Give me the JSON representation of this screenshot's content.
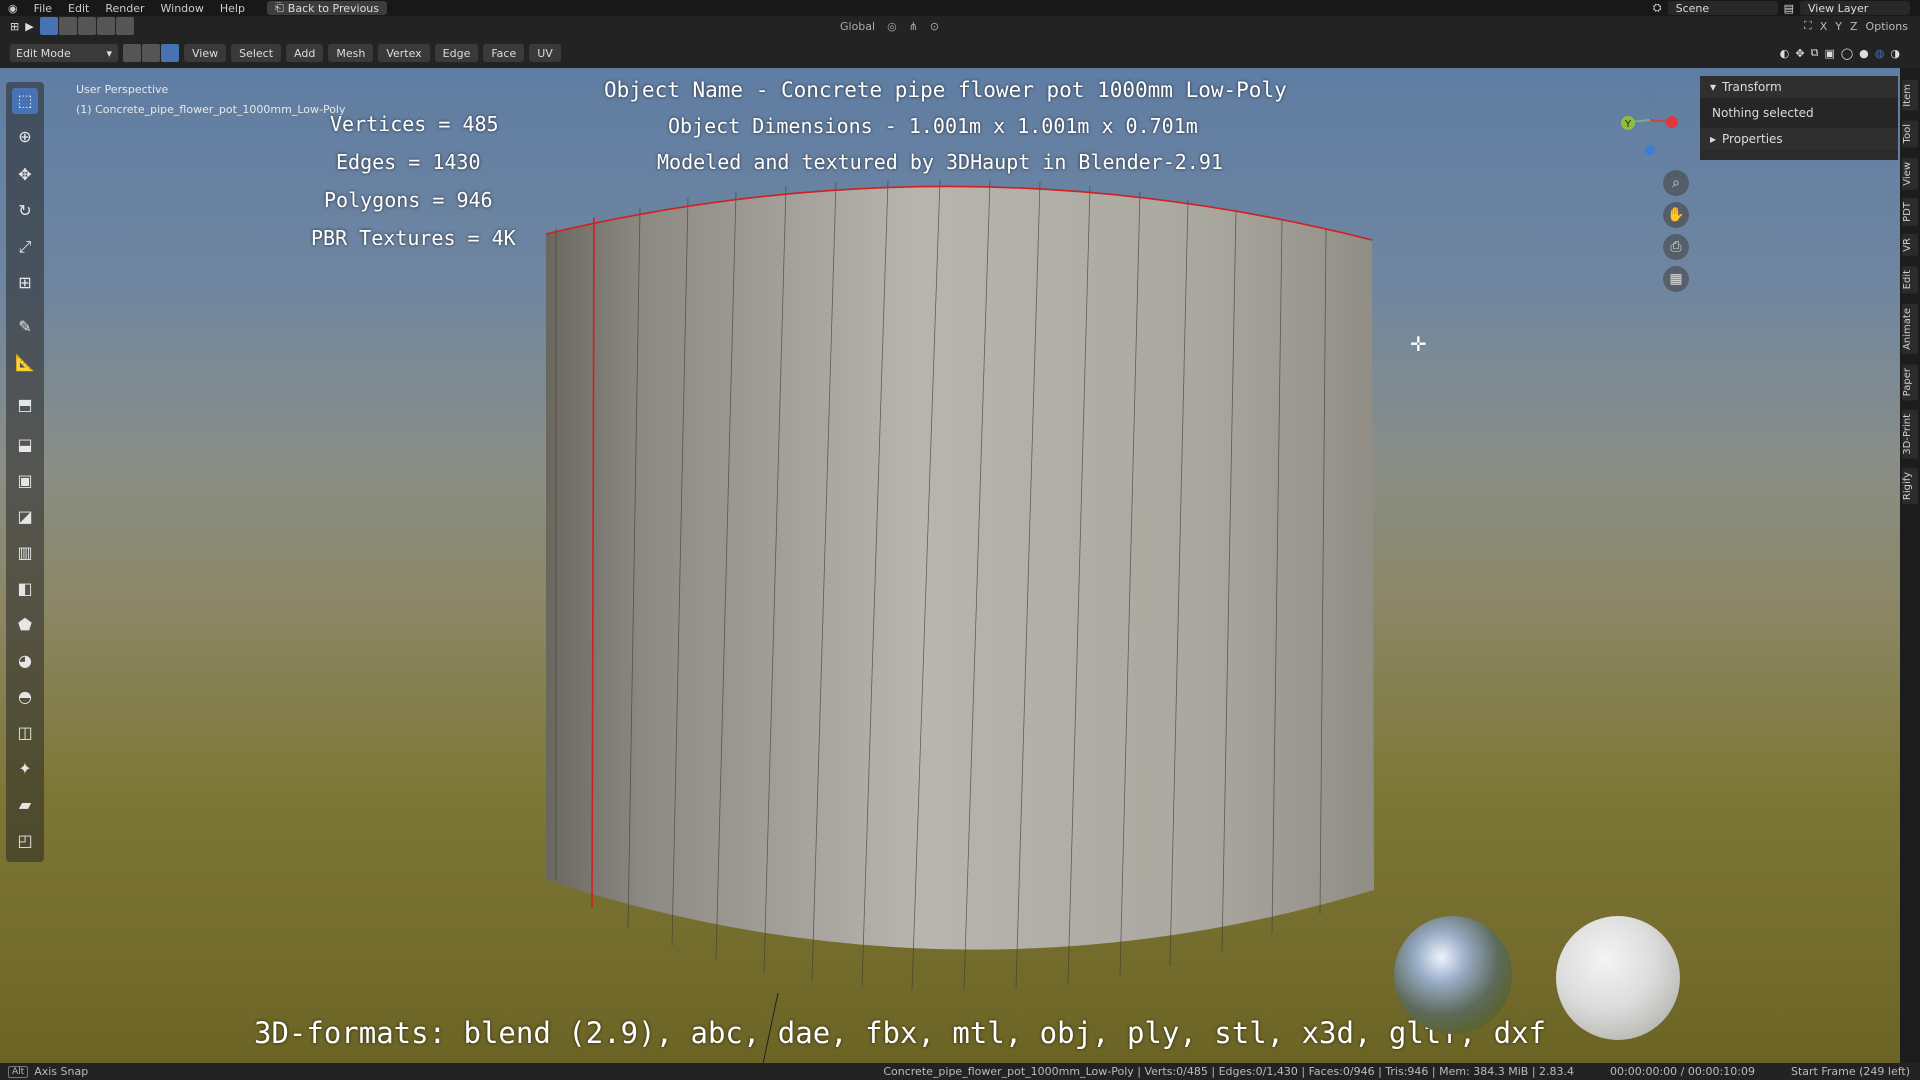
{
  "menu": {
    "items": [
      "File",
      "Edit",
      "Render",
      "Window",
      "Help"
    ],
    "back": "Back to Previous"
  },
  "scene": {
    "scene_label": "Scene",
    "view_layer": "View Layer"
  },
  "header": {
    "mode": "Edit Mode",
    "menus": [
      "View",
      "Select",
      "Add",
      "Mesh",
      "Vertex",
      "Edge",
      "Face",
      "UV"
    ],
    "orientation": "Global",
    "axes": [
      "X",
      "Y",
      "Z"
    ],
    "options": "Options"
  },
  "viewport": {
    "perspective": "User Perspective",
    "object_line": "(1) Concrete_pipe_flower_pot_1000mm_Low-Poly"
  },
  "overlay": {
    "title": "Object Name - Concrete pipe flower pot 1000mm Low-Poly",
    "dimensions": "Object Dimensions -  1.001m x 1.001m x 0.701m",
    "credit": "Modeled and textured by 3DHaupt in Blender-2.91",
    "stats": [
      "Vertices = 485",
      "Edges = 1430",
      "Polygons = 946",
      "PBR Textures = 4K"
    ],
    "formats": "3D-formats: blend (2.9), abc, dae, fbx, mtl, obj, ply, stl, x3d, gltf, dxf"
  },
  "gizmo": {
    "y_label": "Y"
  },
  "npanel": {
    "transform": "Transform",
    "nothing": "Nothing selected",
    "properties": "Properties"
  },
  "side_tabs": [
    "Item",
    "Tool",
    "View",
    "PDT",
    "VR",
    "Edit",
    "Animate",
    "Paper",
    "3D-Print",
    "Rigify"
  ],
  "status": {
    "key": "Alt",
    "left": "Axis Snap",
    "info": "Concrete_pipe_flower_pot_1000mm_Low-Poly | Verts:0/485 | Edges:0/1,430 | Faces:0/946 | Tris:946 | Mem: 384.3 MiB | 2.83.4",
    "time": "00:00:00:00 / 00:00:10:09",
    "frame": "Start Frame (249 left)"
  },
  "colors": {
    "accent": "#4772b3",
    "seam": "#d02020",
    "sky": "#6f86a0",
    "ground": "#7e7838"
  }
}
